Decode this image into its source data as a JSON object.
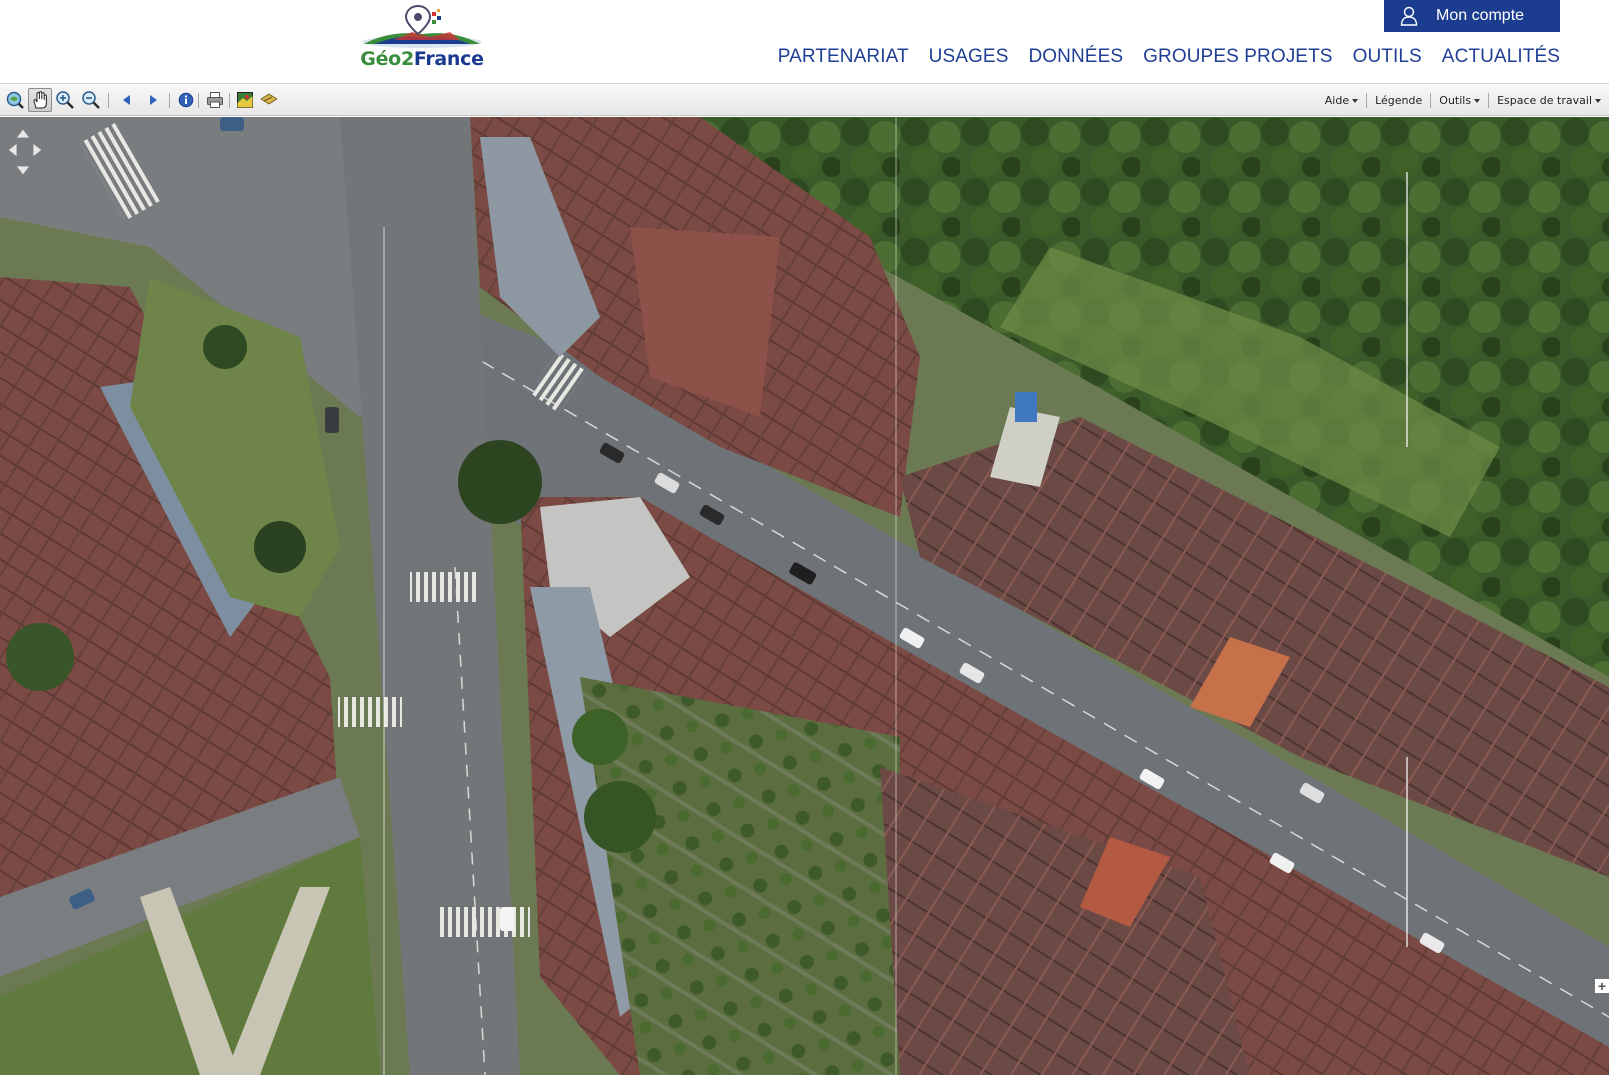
{
  "header": {
    "logo": {
      "text_geo": "Géo",
      "text_two": "2",
      "text_france": "France",
      "icon": "location-pin-logo-icon"
    },
    "account": {
      "label": "Mon compte",
      "icon": "user-icon"
    },
    "nav": [
      {
        "label": "PARTENARIAT"
      },
      {
        "label": "USAGES"
      },
      {
        "label": "DONNÉES"
      },
      {
        "label": "GROUPES PROJETS"
      },
      {
        "label": "OUTILS"
      },
      {
        "label": "ACTUALITÉS"
      }
    ]
  },
  "toolbar": {
    "tools": [
      {
        "name": "zoom-extent-icon"
      },
      {
        "name": "pan-hand-icon",
        "active": true
      },
      {
        "name": "zoom-in-icon"
      },
      {
        "name": "zoom-out-icon"
      },
      {
        "name": "previous-view-icon"
      },
      {
        "name": "next-view-icon"
      },
      {
        "name": "info-icon"
      },
      {
        "name": "print-icon"
      },
      {
        "name": "layers-icon"
      },
      {
        "name": "measure-icon"
      }
    ],
    "menus": [
      {
        "label": "Aide"
      },
      {
        "label": "Légende"
      },
      {
        "label": "Outils"
      },
      {
        "label": "Espace de travail"
      }
    ]
  },
  "map": {
    "layer": "aerial-orthophoto",
    "colors": {
      "road": "#6e7378",
      "roof_red": "#8d5149",
      "roof_brown": "#6a4540",
      "grass": "#5f7a3c",
      "tree": "#2f4a22"
    }
  }
}
